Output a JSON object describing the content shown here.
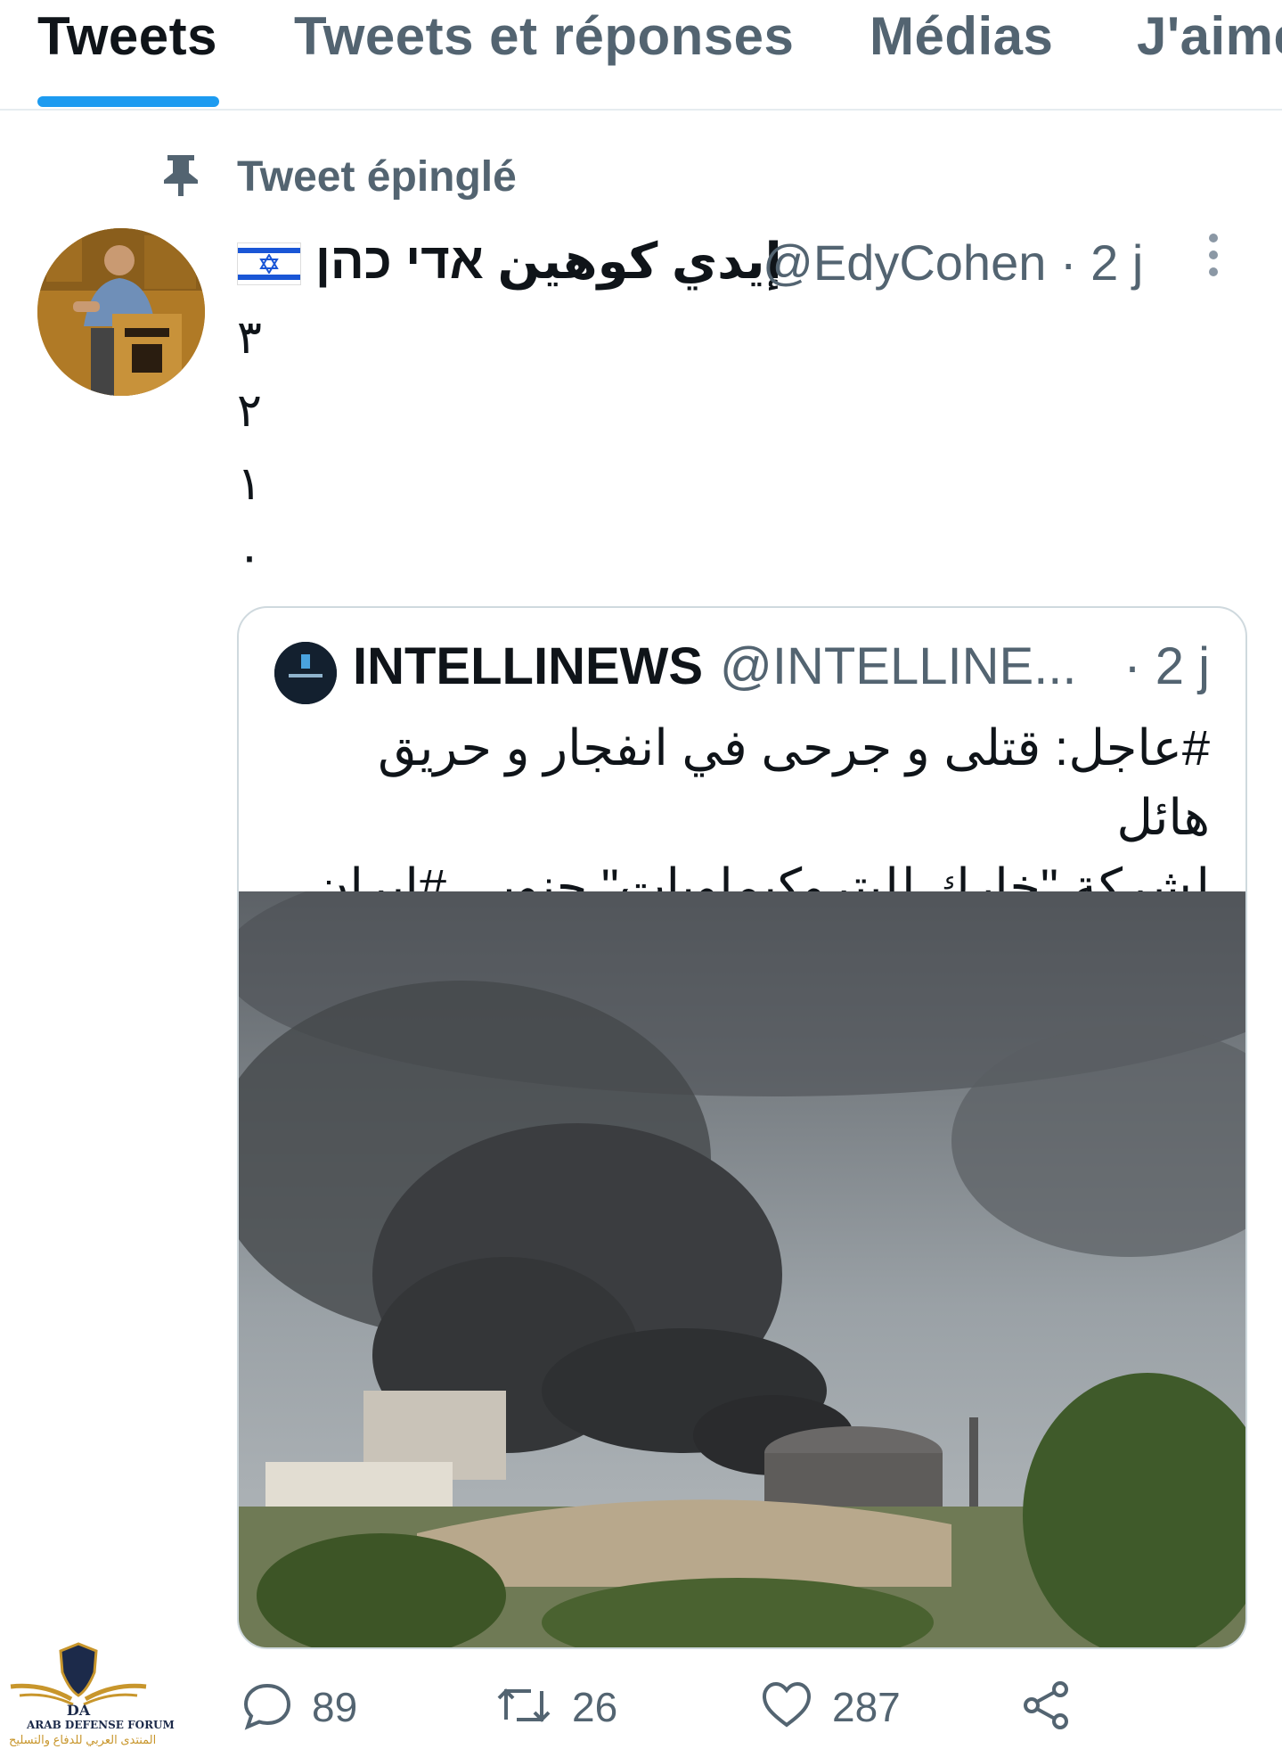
{
  "tabs": [
    {
      "label": "Tweets",
      "active": true
    },
    {
      "label": "Tweets et réponses",
      "active": false
    },
    {
      "label": "Médias",
      "active": false
    },
    {
      "label": "J'aime",
      "active": false
    }
  ],
  "pinned": {
    "label": "Tweet épinglé",
    "icon": "pin-icon"
  },
  "tweet": {
    "author_name": "إيدي كوهين אדי כהן",
    "flag": "israel-flag-icon",
    "handle_time": "@EdyCohen · 2 j",
    "lines": [
      "٣",
      "٢",
      "١",
      "٠"
    ],
    "quoted": {
      "name": "INTELLINEWS",
      "handle": "@INTELLINE...",
      "time": "· 2 j",
      "text_line1": "#عاجل: قتلى و جرحى في انفجار و حريق هائل",
      "text_line2": "لشركة \"خارك للبتروكيماويات\" جنوبي #إيران"
    },
    "actions": {
      "reply_count": "89",
      "retweet_count": "26",
      "like_count": "287"
    }
  },
  "watermark": {
    "line1": "ARAB DEFENSE FORUM",
    "line2": "المنتدى العربي للدفاع والتسليح",
    "mark": "DA"
  },
  "colors": {
    "accent": "#1d9bf0",
    "secondary_text": "#536471",
    "primary_text": "#0f1419",
    "border": "#cfd9de"
  }
}
